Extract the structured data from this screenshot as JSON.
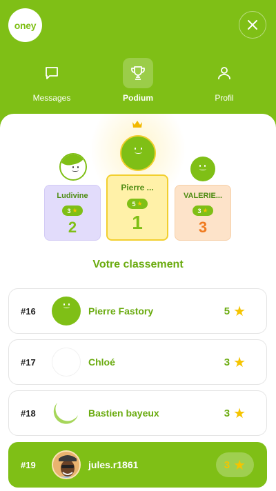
{
  "logo": "oney",
  "nav": [
    {
      "label": "Messages",
      "icon": "chat-icon",
      "active": false
    },
    {
      "label": "Podium",
      "icon": "trophy-icon",
      "active": true
    },
    {
      "label": "Profil",
      "icon": "user-icon",
      "active": false
    }
  ],
  "podium": {
    "first": {
      "name": "Pierre ...",
      "stars": "5",
      "rank": "1"
    },
    "second": {
      "name": "Ludivine",
      "stars": "3",
      "rank": "2"
    },
    "third": {
      "name": "VALERIE...",
      "stars": "3",
      "rank": "3"
    }
  },
  "ranking_title": "Votre classement",
  "leaderboard": [
    {
      "rank": "#16",
      "name": "Pierre Fastory",
      "score": "5"
    },
    {
      "rank": "#17",
      "name": "Chloé",
      "score": "3"
    },
    {
      "rank": "#18",
      "name": "Bastien bayeux",
      "score": "3"
    },
    {
      "rank": "#19",
      "name": "jules.r1861",
      "score": "3",
      "current_user": true
    }
  ],
  "colors": {
    "brand": "#7fbf16",
    "star": "#f5c400",
    "second": "#e2dcfb",
    "first": "#fff1a8",
    "third": "#fde3c9"
  }
}
